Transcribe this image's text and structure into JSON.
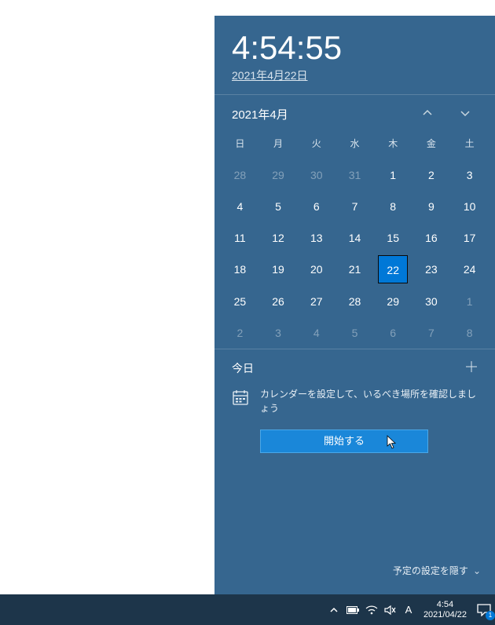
{
  "clock": {
    "time": "4:54:55",
    "date": "2021年4月22日"
  },
  "calendar": {
    "month_label": "2021年4月",
    "dow": [
      "日",
      "月",
      "火",
      "水",
      "木",
      "金",
      "土"
    ],
    "weeks": [
      [
        {
          "n": 28,
          "m": true
        },
        {
          "n": 29,
          "m": true
        },
        {
          "n": 30,
          "m": true
        },
        {
          "n": 31,
          "m": true
        },
        {
          "n": 1
        },
        {
          "n": 2
        },
        {
          "n": 3
        }
      ],
      [
        {
          "n": 4
        },
        {
          "n": 5
        },
        {
          "n": 6
        },
        {
          "n": 7
        },
        {
          "n": 8
        },
        {
          "n": 9
        },
        {
          "n": 10
        }
      ],
      [
        {
          "n": 11
        },
        {
          "n": 12
        },
        {
          "n": 13
        },
        {
          "n": 14
        },
        {
          "n": 15
        },
        {
          "n": 16
        },
        {
          "n": 17
        }
      ],
      [
        {
          "n": 18
        },
        {
          "n": 19
        },
        {
          "n": 20
        },
        {
          "n": 21
        },
        {
          "n": 22,
          "t": true
        },
        {
          "n": 23
        },
        {
          "n": 24
        }
      ],
      [
        {
          "n": 25
        },
        {
          "n": 26
        },
        {
          "n": 27
        },
        {
          "n": 28
        },
        {
          "n": 29
        },
        {
          "n": 30
        },
        {
          "n": 1,
          "m": true
        }
      ],
      [
        {
          "n": 2,
          "m": true
        },
        {
          "n": 3,
          "m": true
        },
        {
          "n": 4,
          "m": true
        },
        {
          "n": 5,
          "m": true
        },
        {
          "n": 6,
          "m": true
        },
        {
          "n": 7,
          "m": true
        },
        {
          "n": 8,
          "m": true
        }
      ]
    ]
  },
  "events": {
    "today_label": "今日",
    "prompt": "カレンダーを設定して、いるべき場所を確認しましょう",
    "start_label": "開始する"
  },
  "footer": {
    "hide_label": "予定の設定を隠す"
  },
  "taskbar": {
    "ime": "A",
    "time": "4:54",
    "date": "2021/04/22",
    "badge": "1"
  }
}
